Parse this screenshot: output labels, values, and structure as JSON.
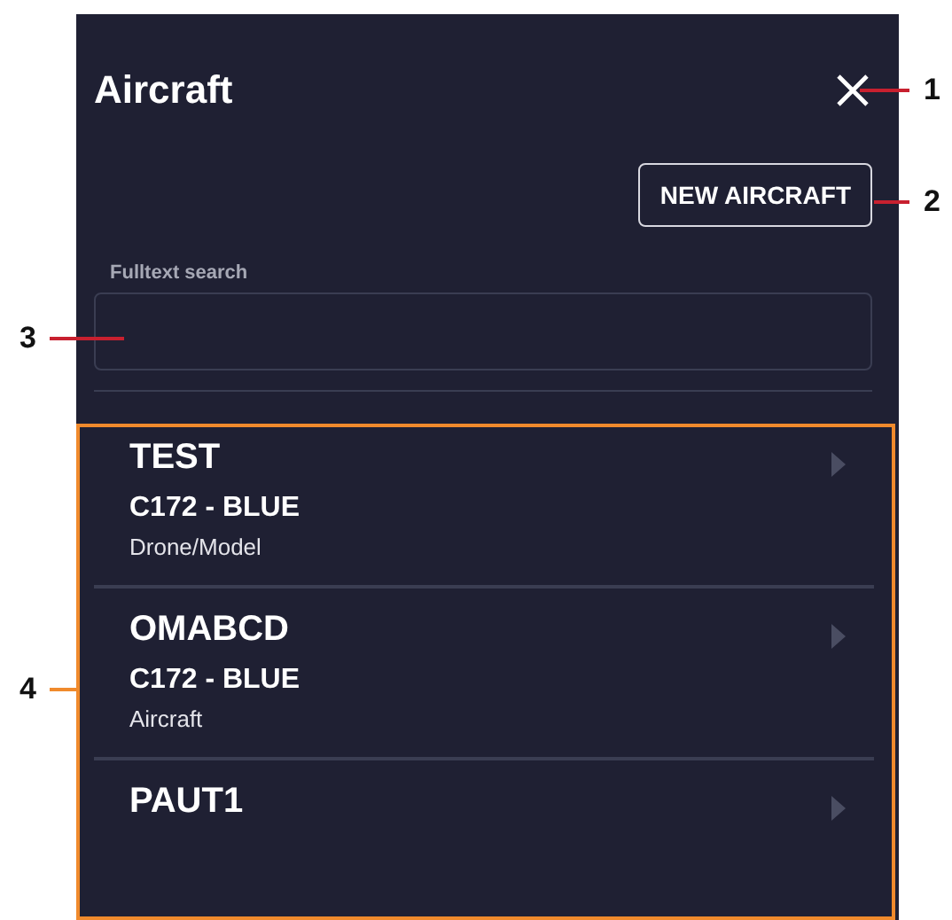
{
  "panel": {
    "title": "Aircraft",
    "new_button": "NEW AIRCRAFT",
    "search": {
      "label": "Fulltext search"
    },
    "items": [
      {
        "registration": "TEST",
        "model": "C172 - BLUE",
        "type": "Drone/Model"
      },
      {
        "registration": "OMABCD",
        "model": "C172 - BLUE",
        "type": "Aircraft"
      },
      {
        "registration": "PAUT1"
      }
    ]
  },
  "callouts": [
    {
      "number": "1",
      "kind": "line",
      "color": "#c8202f"
    },
    {
      "number": "2",
      "kind": "line",
      "color": "#c8202f"
    },
    {
      "number": "3",
      "kind": "line",
      "color": "#c8202f"
    },
    {
      "number": "4",
      "kind": "frame",
      "color": "#f08a2c"
    }
  ]
}
